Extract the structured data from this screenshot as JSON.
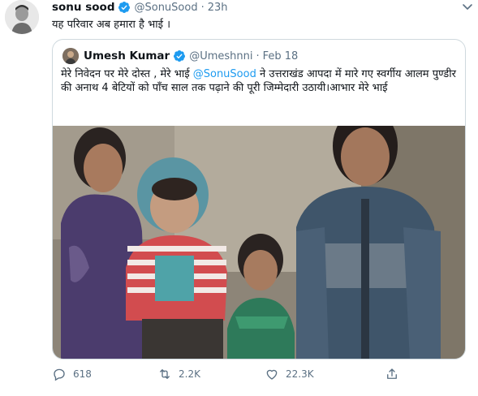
{
  "tweet": {
    "display_name": "sonu sood",
    "handle": "@SonuSood",
    "separator": "·",
    "time": "23h",
    "text": "यह परिवार अब हमारा है भाई ।"
  },
  "quoted_tweet": {
    "display_name": "Umesh Kumar",
    "handle": "@Umeshnni",
    "separator": "·",
    "date": "Feb 18",
    "text_part1": "मेरे निवेदन पर मेरे दोस्त , मेरे भाई ",
    "mention": "@SonuSood",
    "text_part2": "   ने उत्तराखंड आपदा में मारे गए स्वर्गीय आलम पुण्डीर  की अनाथ 4 बेटियों को पाँच साल तक पढ़ाने की पूरी जिम्मेदारी उठायी।आभार मेरे भाई"
  },
  "actions": {
    "reply_count": "618",
    "retweet_count": "2.2K",
    "like_count": "22.3K"
  },
  "icons": {
    "verified": "verified-badge-icon",
    "caret": "chevron-down-icon",
    "reply": "reply-icon",
    "retweet": "retweet-icon",
    "like": "heart-icon",
    "share": "share-icon"
  },
  "colors": {
    "accent": "#1d9bf0",
    "secondary_text": "#5b7083",
    "border": "#cfd9de"
  }
}
